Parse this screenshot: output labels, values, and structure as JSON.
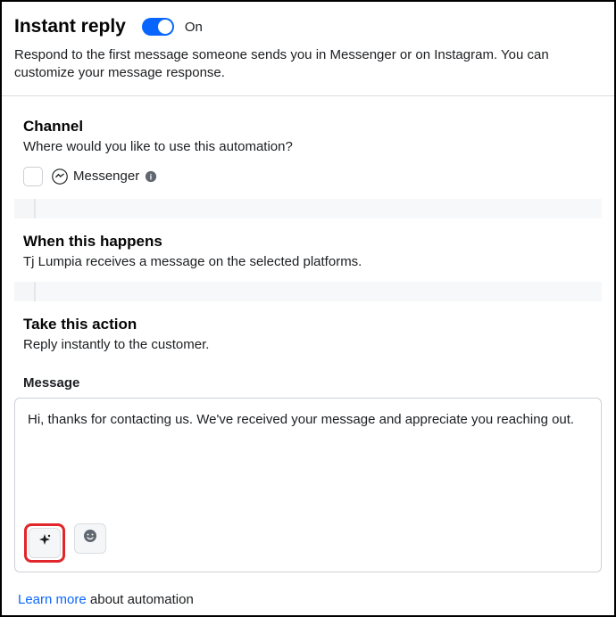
{
  "header": {
    "title": "Instant reply",
    "toggle_state": "On",
    "description": "Respond to the first message someone sends you in Messenger or on Instagram. You can customize your message response."
  },
  "channel": {
    "title": "Channel",
    "subtitle": "Where would you like to use this automation?",
    "platform_label": "Messenger"
  },
  "when": {
    "title": "When this happens",
    "subtitle": "Tj Lumpia receives a message on the selected platforms."
  },
  "action": {
    "title": "Take this action",
    "subtitle": "Reply instantly to the customer."
  },
  "message": {
    "label": "Message",
    "text": "Hi, thanks for contacting us. We've received your message and appreciate you reaching out."
  },
  "footer": {
    "link_text": "Learn more",
    "rest_text": " about automation"
  }
}
